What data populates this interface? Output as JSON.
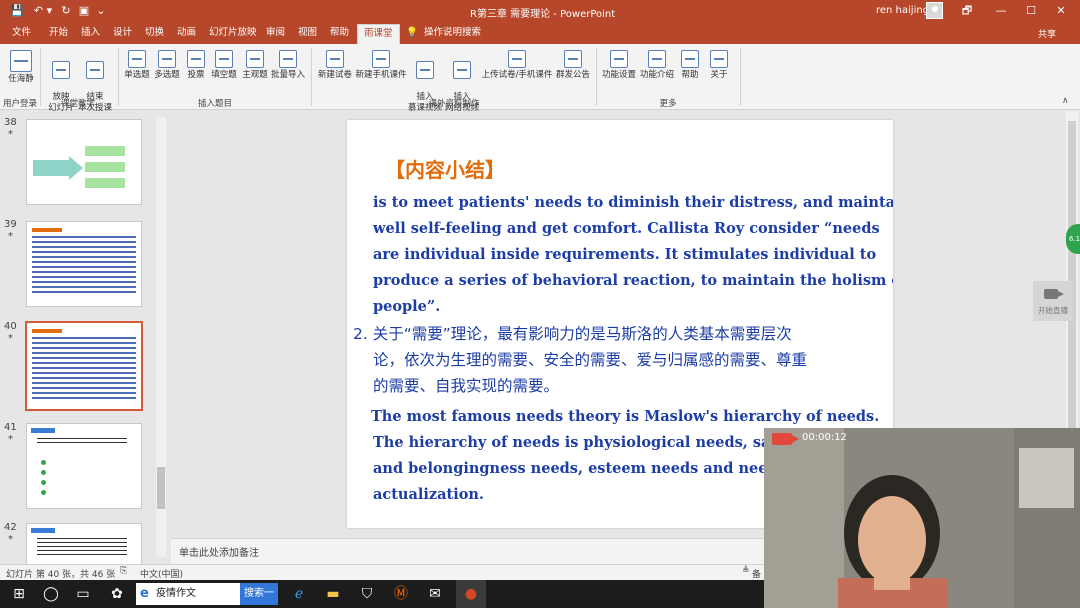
{
  "window": {
    "title": "R第三章  需要理论  -  PowerPoint",
    "user": "ren haijing",
    "buttons": [
      "🗗",
      "—",
      "☐",
      "✕"
    ]
  },
  "tabs": [
    "文件",
    "开始",
    "插入",
    "设计",
    "切换",
    "动画",
    "幻灯片放映",
    "审阅",
    "视图",
    "帮助",
    "雨课堂",
    "操作说明搜索"
  ],
  "active_tab": "雨课堂",
  "share": "共享",
  "ribbon": {
    "user_login": "任海静",
    "groups": [
      "用户登录",
      "课堂教学",
      "插入题目",
      "课外资料制作",
      "更多"
    ],
    "buttons": [
      {
        "label": "放映\n幻灯片"
      },
      {
        "label": "结束\n本次授课"
      },
      {
        "label": "单选题"
      },
      {
        "label": "多选题"
      },
      {
        "label": "投票"
      },
      {
        "label": "填空题"
      },
      {
        "label": "主观题"
      },
      {
        "label": "批量导入"
      },
      {
        "label": "新建试卷"
      },
      {
        "label": "新建手机课件"
      },
      {
        "label": "插入\n慕课视频"
      },
      {
        "label": "插入\n网络视频"
      },
      {
        "label": "上传试卷/手机课件"
      },
      {
        "label": "群发公告"
      },
      {
        "label": "功能设置"
      },
      {
        "label": "功能介绍"
      },
      {
        "label": "帮助"
      },
      {
        "label": "关于"
      }
    ]
  },
  "thumbnails": [
    {
      "num": "38",
      "star": "*"
    },
    {
      "num": "39",
      "star": "*"
    },
    {
      "num": "40",
      "star": "*"
    },
    {
      "num": "41",
      "star": "*"
    },
    {
      "num": "42",
      "star": "*"
    }
  ],
  "slide": {
    "heading": "【内容小结】",
    "en_lines": [
      " is to meet patients' needs to diminish their distress, and maintain",
      "well self-feeling and get comfort. Callista Roy consider “needs",
      "are individual inside requirements. It stimulates individual to",
      "produce a series of behavioral reaction, to maintain the holism of",
      "people”."
    ],
    "cn_lines": [
      "2. 关于“需要”理论，最有影响力的是马斯洛的人类基本需要层次",
      "论，依次为生理的需要、安全的需要、爱与归属感的需要、尊重",
      "的需要、自我实现的需要。"
    ],
    "en2_lines": [
      "The most famous needs theory is Maslow's hierarchy of needs.",
      "The hierarchy of needs is physiological needs, safety",
      "and belongingness needs, esteem needs and needs o",
      "actualization."
    ]
  },
  "notes_placeholder": "单击此处添加备注",
  "status": {
    "slide_info": "幻灯片 第 40 张，共 46 张",
    "language": "中文(中国)",
    "notes_label": "备"
  },
  "taskbar": {
    "search_text": "疫情作文",
    "search_button": "搜索一下"
  },
  "webcam": {
    "timer": "00:00:12"
  },
  "float_record_label": "开始直播",
  "float_green_label": "6.1",
  "colors": {
    "accent": "#b7472a",
    "slide_text": "#1c3da6",
    "heading": "#e36c0a"
  }
}
